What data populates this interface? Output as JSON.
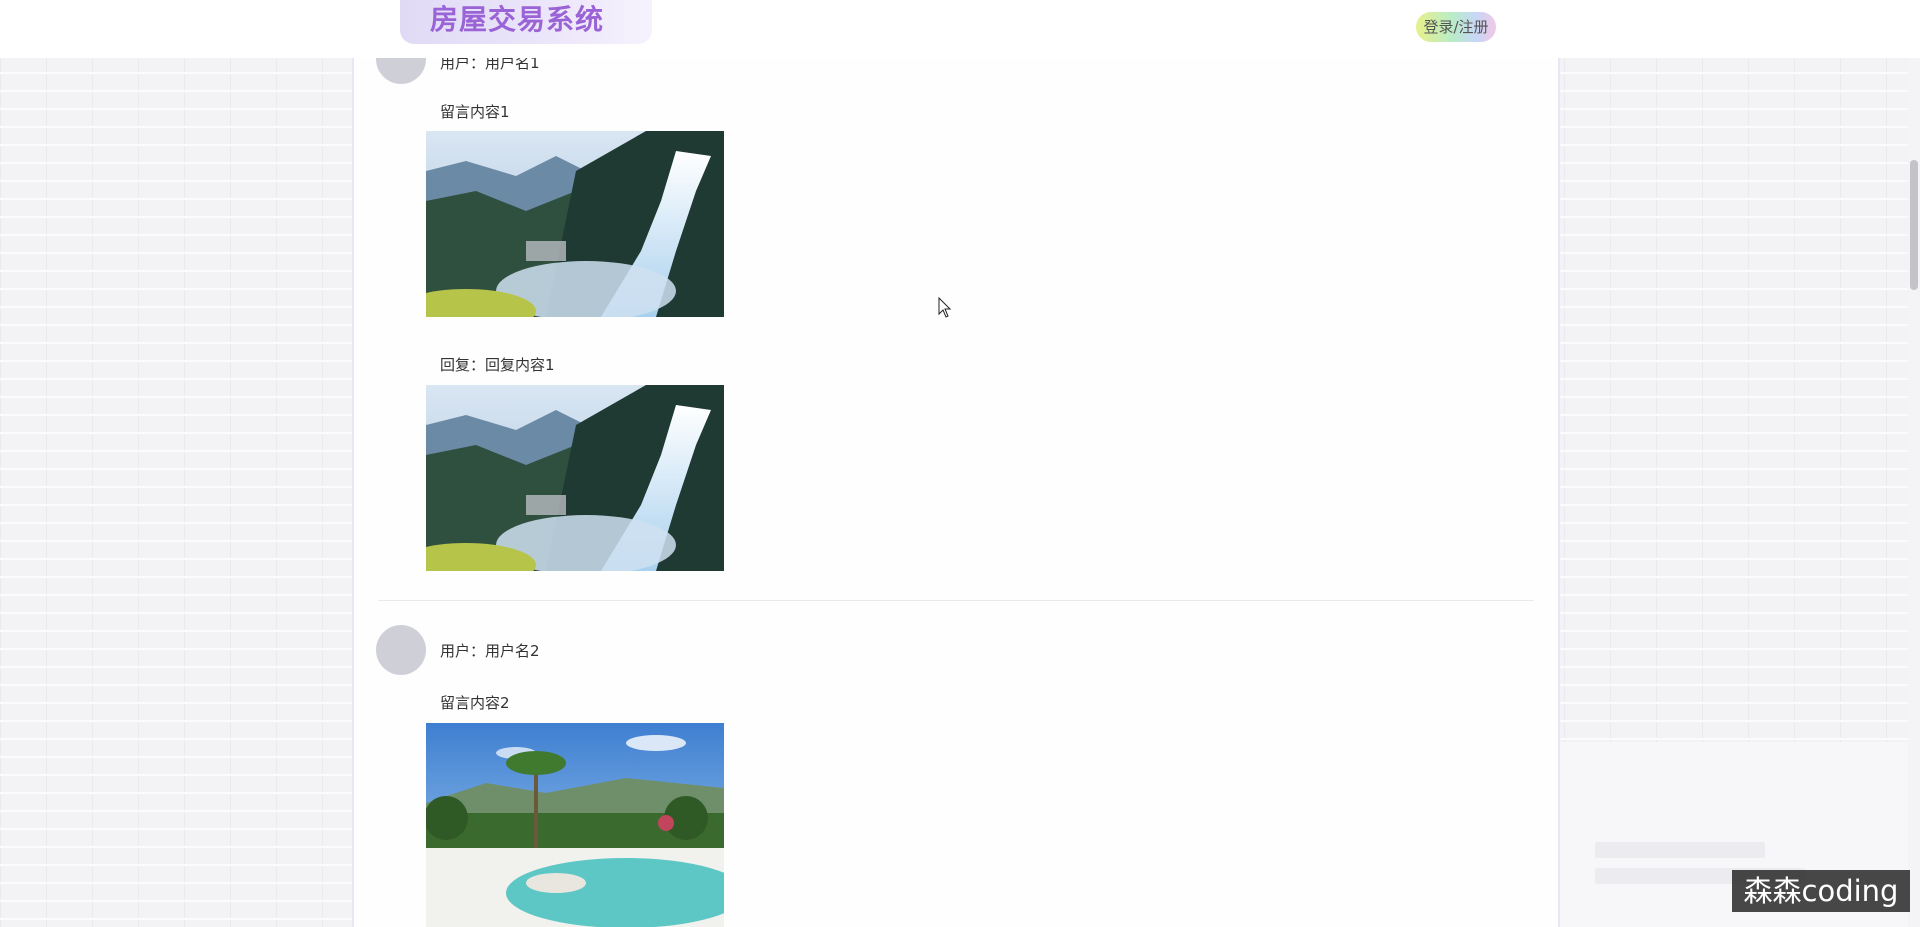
{
  "header": {
    "logo_text": "房屋交易系统",
    "login_register": "登录/注册"
  },
  "messages": [
    {
      "user": "用户：用户名1",
      "content": "留言内容1",
      "content_image_icon": "waterfall-photo",
      "reply": "回复：回复内容1",
      "reply_image_icon": "waterfall-photo"
    },
    {
      "user": "用户：用户名2",
      "content": "留言内容2",
      "content_image_icon": "tropical-pool-photo"
    }
  ],
  "watermark": "森森coding"
}
